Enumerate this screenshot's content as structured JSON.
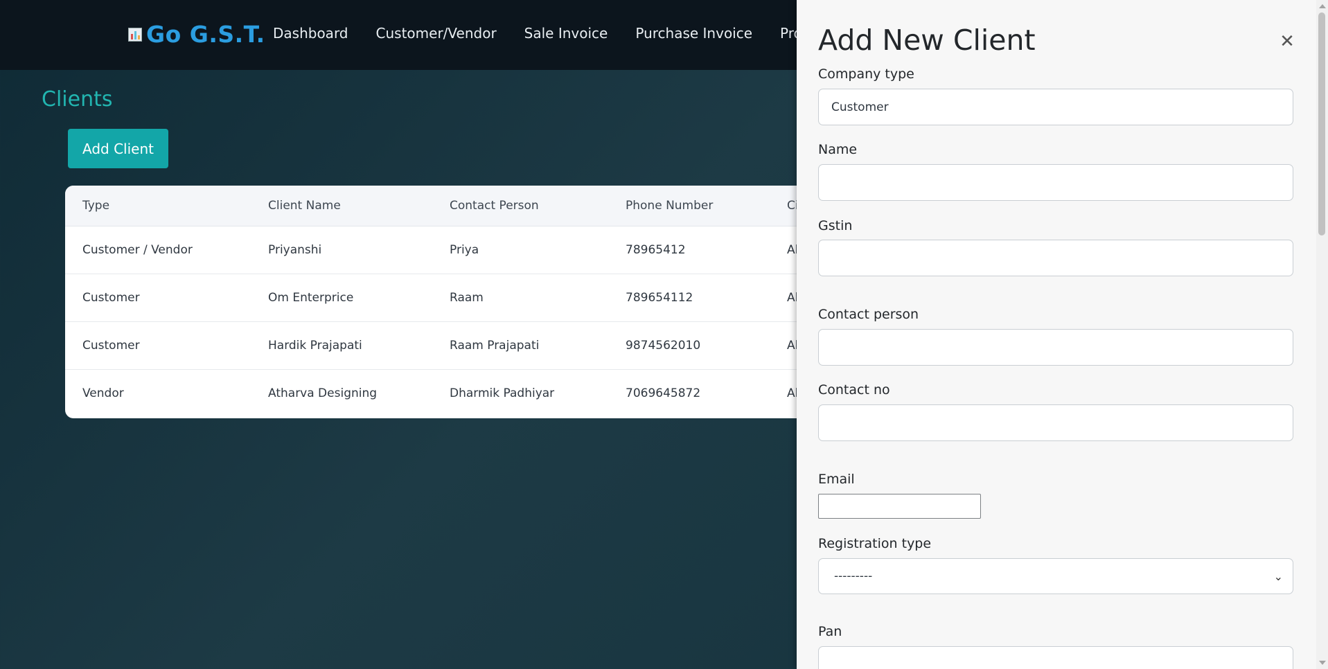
{
  "brand": {
    "name": "Go G.S.T.",
    "icon": "chart-icon"
  },
  "nav": [
    "Dashboard",
    "Customer/Vendor",
    "Sale Invoice",
    "Purchase Invoice",
    "Products"
  ],
  "page": {
    "title": "Clients",
    "add_button": "Add Client"
  },
  "table": {
    "headers": [
      "Type",
      "Client Name",
      "Contact Person",
      "Phone Number",
      "Ci"
    ],
    "rows": [
      [
        "Customer / Vendor",
        "Priyanshi",
        "Priya",
        "78965412",
        "Al"
      ],
      [
        "Customer",
        "Om Enterprice",
        "Raam",
        "789654112",
        "Al"
      ],
      [
        "Customer",
        "Hardik Prajapati",
        "Raam Prajapati",
        "9874562010",
        "Al"
      ],
      [
        "Vendor",
        "Atharva Designing",
        "Dharmik Padhiyar",
        "7069645872",
        "Al"
      ]
    ]
  },
  "panel": {
    "title": "Add New Client",
    "close_icon": "close-icon",
    "fields": {
      "company_type": {
        "label": "Company type",
        "value": "Customer"
      },
      "name": {
        "label": "Name",
        "value": ""
      },
      "gstin": {
        "label": "Gstin",
        "value": ""
      },
      "contact_person": {
        "label": "Contact person",
        "value": ""
      },
      "contact_no": {
        "label": "Contact no",
        "value": ""
      },
      "email": {
        "label": "Email",
        "value": ""
      },
      "registration_type": {
        "label": "Registration type",
        "value": "---------"
      },
      "pan": {
        "label": "Pan",
        "value": ""
      }
    }
  }
}
